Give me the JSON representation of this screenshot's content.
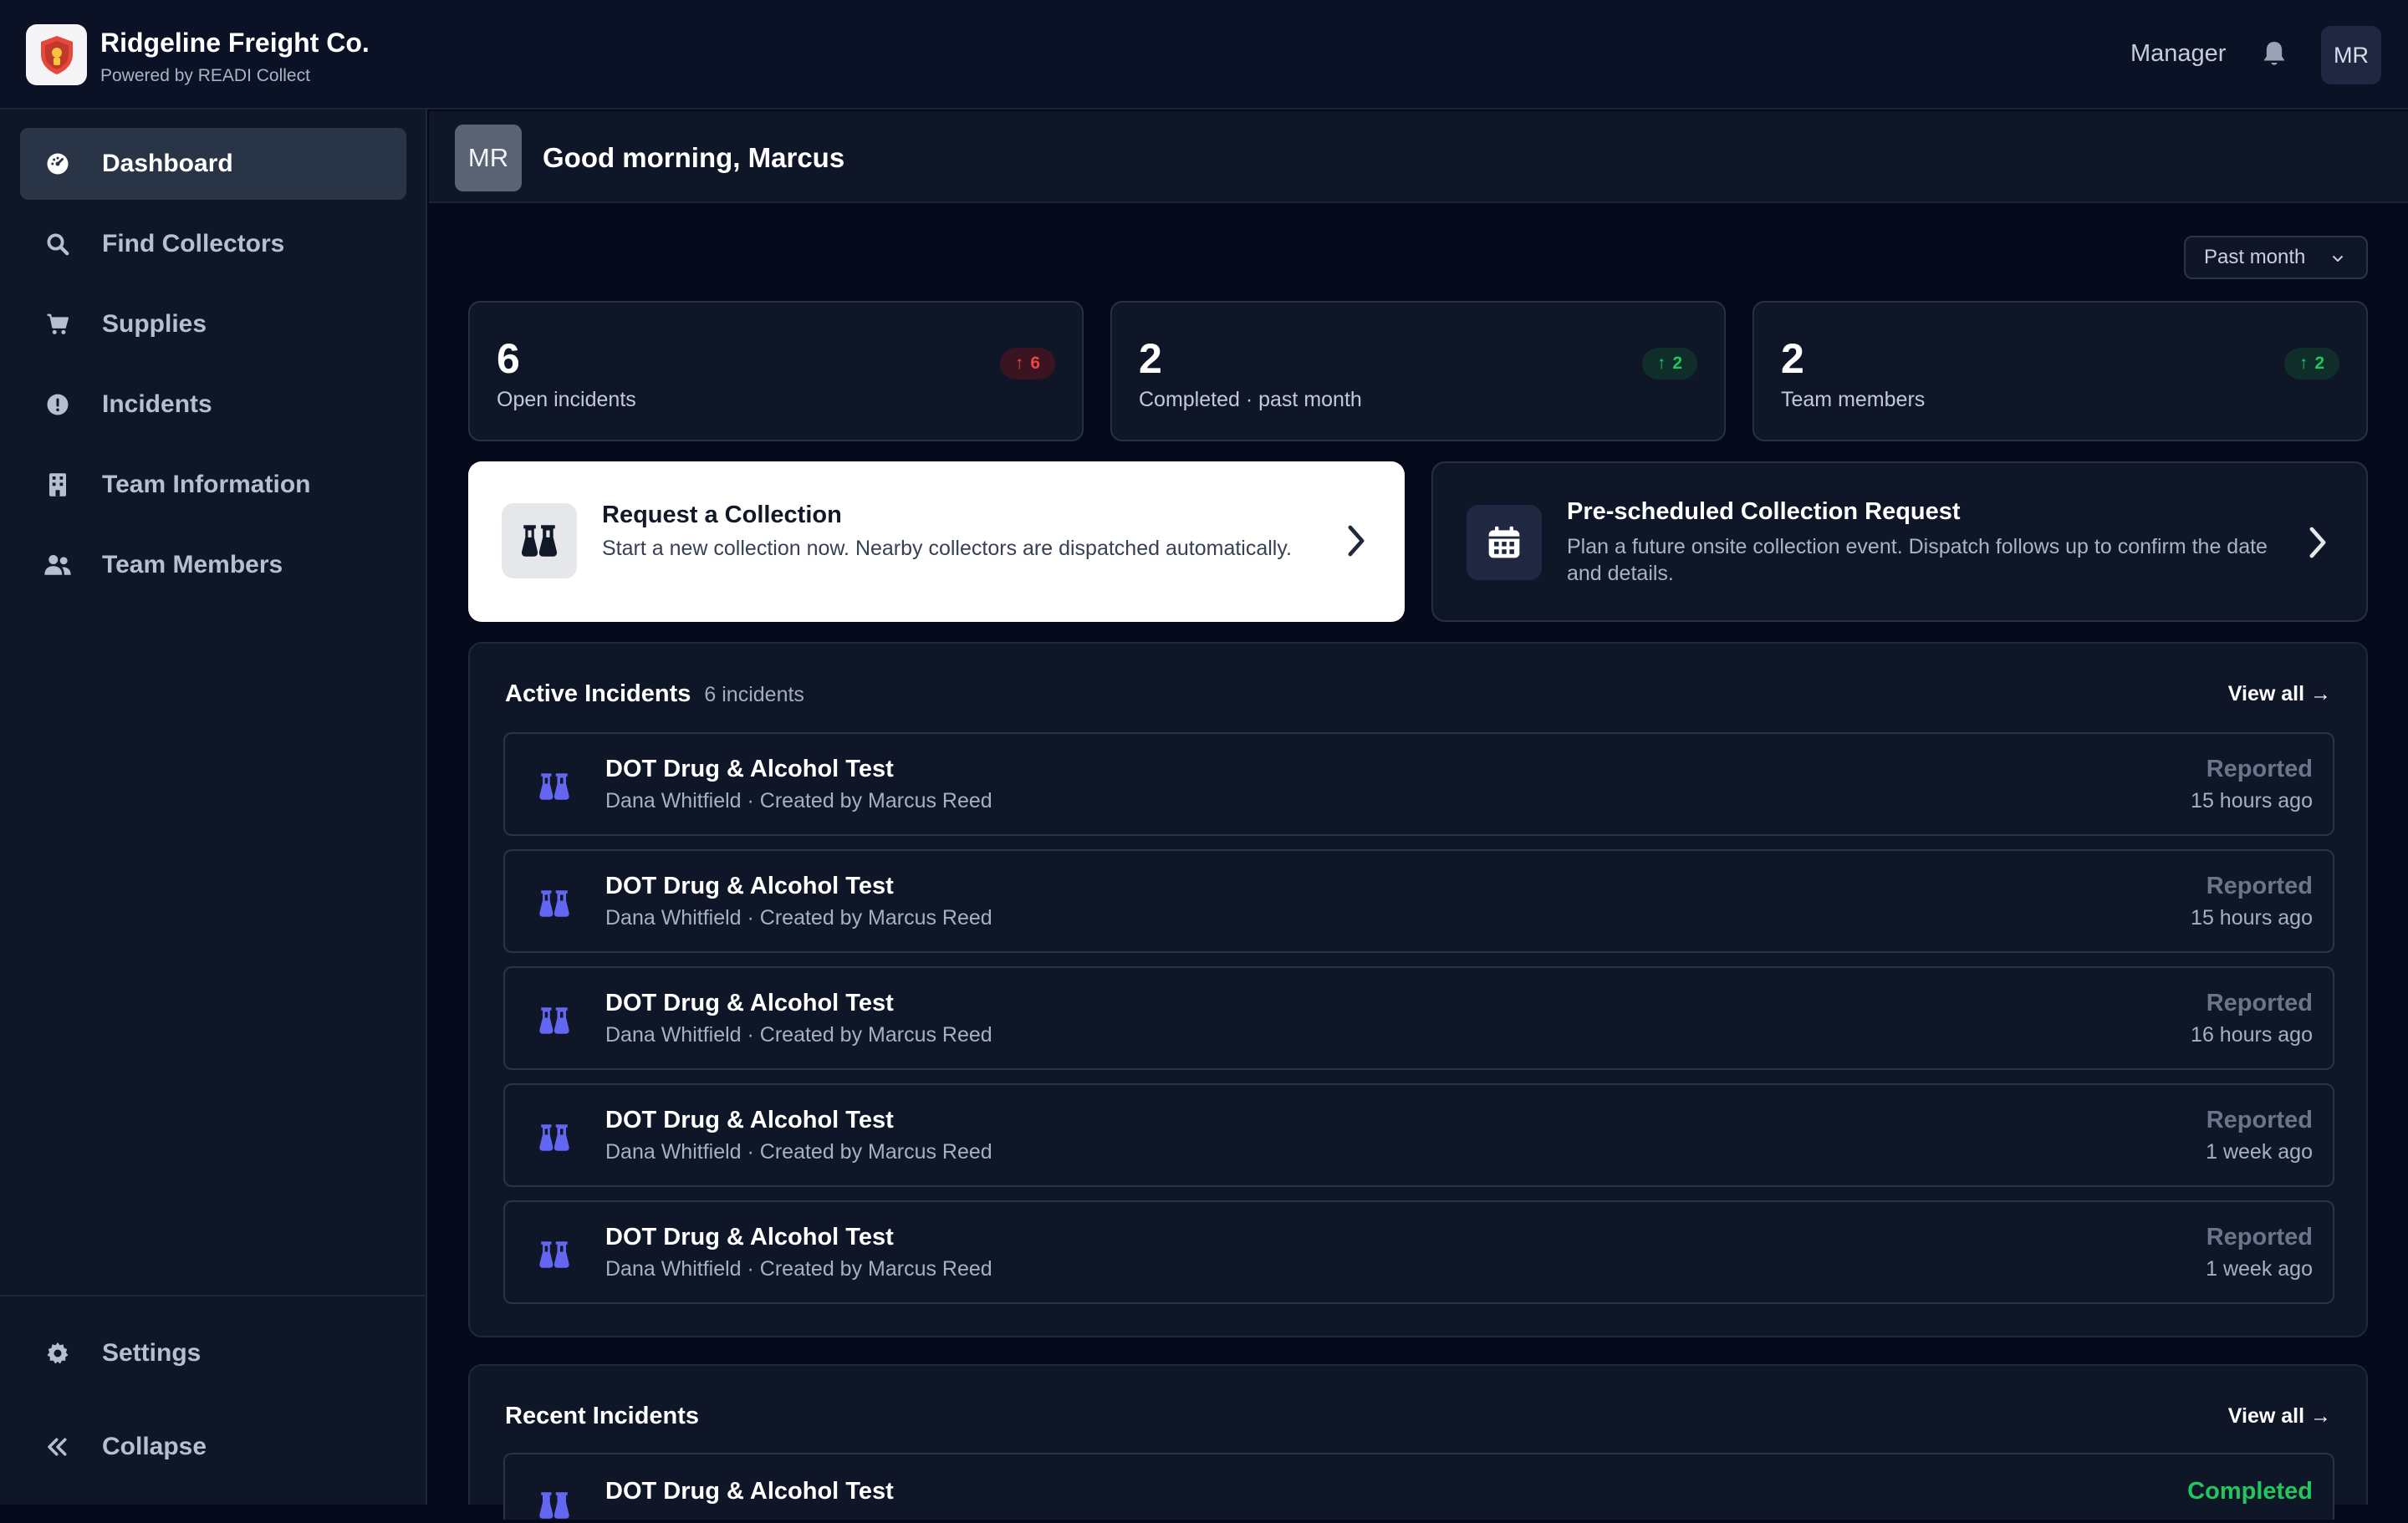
{
  "brand": {
    "name": "Ridgeline Freight Co.",
    "subtitle": "Powered by READI Collect"
  },
  "header": {
    "role": "Manager",
    "avatar_initials": "MR",
    "bell_icon": "bell-icon"
  },
  "sidebar": {
    "items": [
      {
        "label": "Dashboard",
        "icon": "dashboard-icon",
        "active": true
      },
      {
        "label": "Find Collectors",
        "icon": "search-icon",
        "active": false
      },
      {
        "label": "Supplies",
        "icon": "cart-icon",
        "active": false
      },
      {
        "label": "Incidents",
        "icon": "alert-circle-icon",
        "active": false
      },
      {
        "label": "Team Information",
        "icon": "building-icon",
        "active": false
      },
      {
        "label": "Team Members",
        "icon": "users-icon",
        "active": false
      }
    ],
    "settings_label": "Settings",
    "collapse_label": "Collapse"
  },
  "greeting": {
    "avatar_initials": "MR",
    "text": "Good morning, Marcus"
  },
  "period": {
    "selected": "Past month"
  },
  "stats": [
    {
      "value": "6",
      "label": "Open incidents",
      "badge": "6",
      "trend": "up",
      "tone": "red"
    },
    {
      "value": "2",
      "label": "Completed · past month",
      "badge": "2",
      "trend": "up",
      "tone": "green"
    },
    {
      "value": "2",
      "label": "Team members",
      "badge": "2",
      "trend": "up",
      "tone": "green"
    }
  ],
  "actions": {
    "request": {
      "title": "Request a Collection",
      "description": "Start a new collection now. Nearby collectors are dispatched automatically."
    },
    "prescheduled": {
      "title": "Pre-scheduled Collection Request",
      "description": "Plan a future onsite collection event. Dispatch follows up to confirm the date and details."
    }
  },
  "active_incidents": {
    "title": "Active Incidents",
    "count": "6 incidents",
    "view_all": "View all →",
    "items": [
      {
        "title": "DOT Drug & Alcohol Test",
        "subtitle": "Dana Whitfield · Created by Marcus Reed",
        "status": "Reported",
        "time": "15 hours ago"
      },
      {
        "title": "DOT Drug & Alcohol Test",
        "subtitle": "Dana Whitfield · Created by Marcus Reed",
        "status": "Reported",
        "time": "15 hours ago"
      },
      {
        "title": "DOT Drug & Alcohol Test",
        "subtitle": "Dana Whitfield · Created by Marcus Reed",
        "status": "Reported",
        "time": "16 hours ago"
      },
      {
        "title": "DOT Drug & Alcohol Test",
        "subtitle": "Dana Whitfield · Created by Marcus Reed",
        "status": "Reported",
        "time": "1 week ago"
      },
      {
        "title": "DOT Drug & Alcohol Test",
        "subtitle": "Dana Whitfield · Created by Marcus Reed",
        "status": "Reported",
        "time": "1 week ago"
      }
    ]
  },
  "recent_incidents": {
    "title": "Recent Incidents",
    "view_all": "View all →",
    "items": [
      {
        "title": "DOT Drug & Alcohol Test",
        "status": "Completed"
      }
    ]
  },
  "colors": {
    "background": "#040a1c",
    "surface": "#0f1628",
    "accent_icon": "#6366f1",
    "danger": "#ef4444",
    "success": "#22c55e"
  }
}
